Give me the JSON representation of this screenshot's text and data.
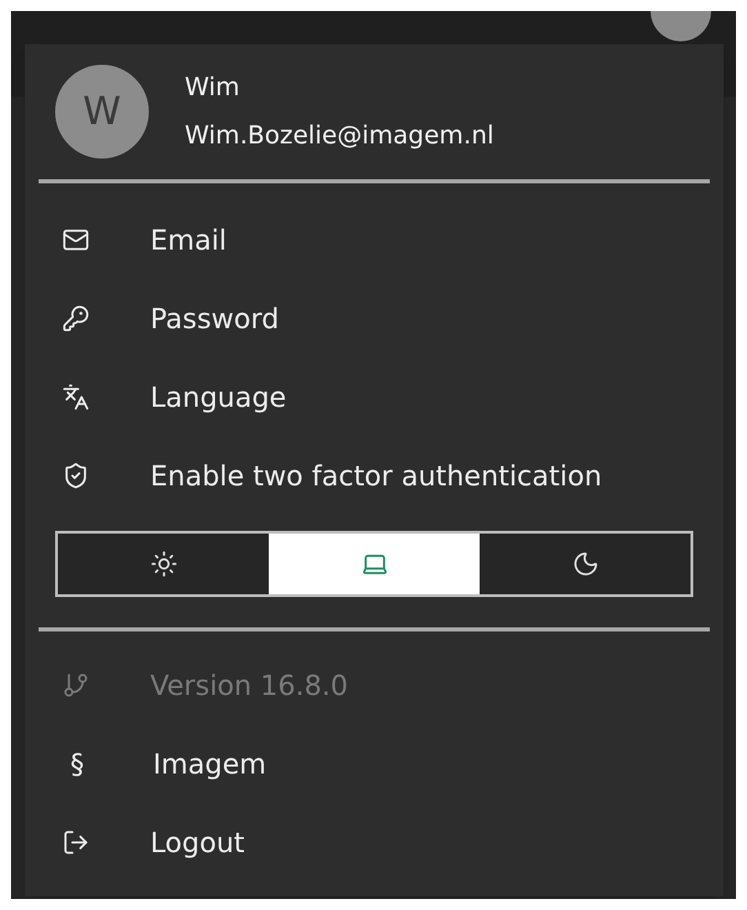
{
  "user": {
    "initial": "W",
    "name": "Wim",
    "email": "Wim.Bozelie@imagem.nl"
  },
  "menu": [
    {
      "kind": "mail",
      "label": "Email"
    },
    {
      "kind": "key",
      "label": "Password"
    },
    {
      "kind": "language",
      "label": "Language"
    },
    {
      "kind": "shield",
      "label": "Enable two factor authentication"
    }
  ],
  "theme": [
    {
      "kind": "sun",
      "selected": false
    },
    {
      "kind": "laptop",
      "selected": true
    },
    {
      "kind": "moon",
      "selected": false
    }
  ],
  "footer": [
    {
      "kind": "branch",
      "label": "Version 16.8.0",
      "disabled": true
    },
    {
      "kind": "char",
      "char": "§",
      "label": "Imagem",
      "disabled": false
    },
    {
      "kind": "logout",
      "label": "Logout",
      "disabled": false
    }
  ]
}
